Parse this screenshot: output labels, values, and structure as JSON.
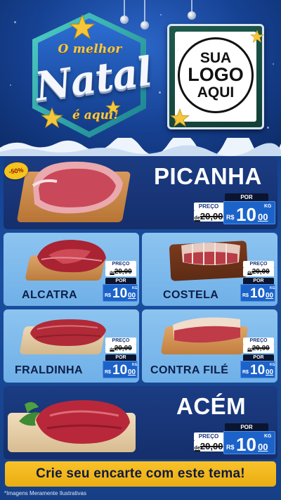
{
  "header": {
    "badge_top": "O melhor",
    "badge_main": "Natal",
    "badge_bottom": "é aqui!",
    "logo_line1": "SUA",
    "logo_line2": "LOGO",
    "logo_line3": "AQUI"
  },
  "discount_badge": "-50%",
  "price_labels": {
    "preco": "PREÇO",
    "por": "POR",
    "de": "de",
    "currency": "R$",
    "unit": "KG"
  },
  "products": [
    {
      "name": "PICANHA",
      "old_price": "20,00",
      "price_int": "10",
      "price_cents": "00"
    },
    {
      "name": "ALCATRA",
      "old_price": "20,00",
      "price_int": "10",
      "price_cents": "00"
    },
    {
      "name": "COSTELA",
      "old_price": "20,00",
      "price_int": "10",
      "price_cents": "00"
    },
    {
      "name": "FRALDINHA",
      "old_price": "20,00",
      "price_int": "10",
      "price_cents": "00"
    },
    {
      "name": "CONTRA FILÉ",
      "old_price": "20,00",
      "price_int": "10",
      "price_cents": "00"
    },
    {
      "name": "ACÉM",
      "old_price": "20,00",
      "price_int": "10",
      "price_cents": "00"
    }
  ],
  "cta": "Crie seu encarte com este tema!",
  "disclaimer": "*Imagens Meramente Ilustrativas",
  "colors": {
    "gold": "#f6c945",
    "panel_dark": "#1b3c83",
    "panel_light": "#8dc4f0",
    "price_blue": "#1c63c9",
    "cta_yellow": "#f9c22a"
  }
}
